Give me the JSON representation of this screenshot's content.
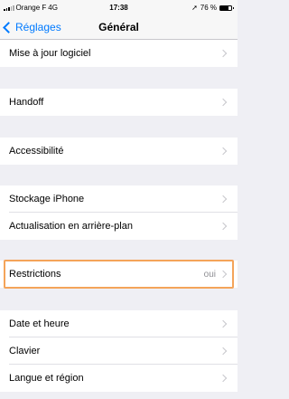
{
  "status_bar": {
    "carrier": "Orange F",
    "network": "4G",
    "time": "17:38",
    "battery": "76 %",
    "battery_level": 0.76
  },
  "nav": {
    "back_label": "Réglages",
    "title": "Général"
  },
  "rows": [
    {
      "label": "Mise à jour logiciel"
    },
    {
      "label": "Handoff"
    },
    {
      "label": "Accessibilité"
    },
    {
      "label": "Stockage iPhone"
    },
    {
      "label": "Actualisation en arrière-plan"
    },
    {
      "label": "Restrictions",
      "value": "oui"
    },
    {
      "label": "Date et heure"
    },
    {
      "label": "Clavier"
    },
    {
      "label": "Langue et région"
    }
  ],
  "colors": {
    "accent": "#007aff",
    "highlight": "#f4a45a",
    "background": "#efeff4"
  }
}
